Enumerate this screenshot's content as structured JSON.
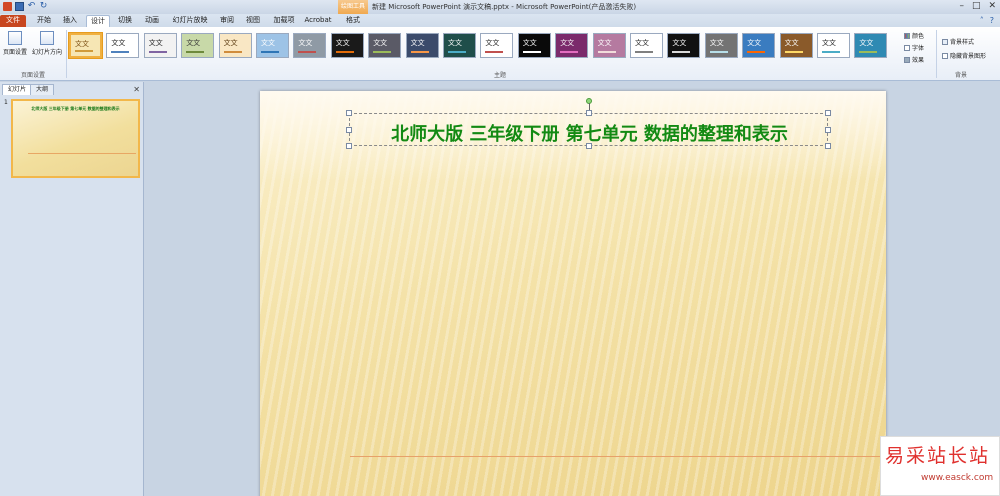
{
  "window": {
    "title": "新建 Microsoft PowerPoint 演示文稿.pptx  -  Microsoft PowerPoint(产品激活失败)",
    "context_tab_group": "绘图工具"
  },
  "tabs": [
    "文件",
    "开始",
    "插入",
    "设计",
    "切换",
    "动画",
    "幻灯片放映",
    "审阅",
    "视图",
    "加载项",
    "Acrobat",
    "格式"
  ],
  "ribbon": {
    "page_setup_label": "页面设置",
    "orientation_label": "幻灯片方向",
    "page_setup_group": "页面设置",
    "themes_group": "主题",
    "theme_sample_text": "文文",
    "theme_first_text": "文文",
    "colors_label": "颜色",
    "fonts_label": "字体",
    "effects_label": "效果",
    "bg_style_label": "背景样式",
    "hide_bg_label": "隐藏背景图形",
    "bg_group": "背景"
  },
  "themes": [
    {
      "bg": "#f6e6b4",
      "fg": "#7a4d10",
      "bar": "#d09a3a"
    },
    {
      "bg": "#ffffff",
      "fg": "#222",
      "bar": "#4f81bd"
    },
    {
      "bg": "#f2f2f2",
      "fg": "#222",
      "bar": "#8064a2"
    },
    {
      "bg": "#c8d9a8",
      "fg": "#333",
      "bar": "#6e8a3c"
    },
    {
      "bg": "#f9e7c4",
      "fg": "#5a3a10",
      "bar": "#d08c3c"
    },
    {
      "bg": "#9dc3e6",
      "fg": "#fff",
      "bar": "#2e75b6"
    },
    {
      "bg": "#8f9aa5",
      "fg": "#fff",
      "bar": "#c0504d"
    },
    {
      "bg": "#1a1a1a",
      "fg": "#fff",
      "bar": "#e36c09"
    },
    {
      "bg": "#5a5a66",
      "fg": "#fff",
      "bar": "#9bbb59"
    },
    {
      "bg": "#3b4b6b",
      "fg": "#fff",
      "bar": "#f79646"
    },
    {
      "bg": "#1f4e4a",
      "fg": "#fff",
      "bar": "#4bacc6"
    },
    {
      "bg": "#ffffff",
      "fg": "#222",
      "bar": "#c0504d"
    },
    {
      "bg": "#0a0a0a",
      "fg": "#fff",
      "bar": "#ffffff"
    },
    {
      "bg": "#7b2a6b",
      "fg": "#fff",
      "bar": "#e36cbf"
    },
    {
      "bg": "#b57aa0",
      "fg": "#fff",
      "bar": "#f2dcdb"
    },
    {
      "bg": "#ffffff",
      "fg": "#222",
      "bar": "#7f7f7f"
    },
    {
      "bg": "#111111",
      "fg": "#fff",
      "bar": "#d9d9d9"
    },
    {
      "bg": "#737373",
      "fg": "#fff",
      "bar": "#b7dee8"
    },
    {
      "bg": "#3a7cc0",
      "fg": "#fff",
      "bar": "#ff6600"
    },
    {
      "bg": "#8a5a2a",
      "fg": "#fff",
      "bar": "#ffd966"
    },
    {
      "bg": "#ffffff",
      "fg": "#222",
      "bar": "#4bacc6"
    },
    {
      "bg": "#2f8ab3",
      "fg": "#fff",
      "bar": "#9bbb59"
    }
  ],
  "left_pane": {
    "tab_slides": "幻灯片",
    "tab_outline": "大纲",
    "slide_number": "1"
  },
  "slide": {
    "title": "北师大版  三年级下册  第七单元  数据的整理和表示"
  },
  "watermark": {
    "text": "易采站长站",
    "url": "www.easck.com"
  },
  "colors": {
    "title_green": "#138a13",
    "file_tab": "#c8461f",
    "accent_orange": "#f0b040"
  }
}
